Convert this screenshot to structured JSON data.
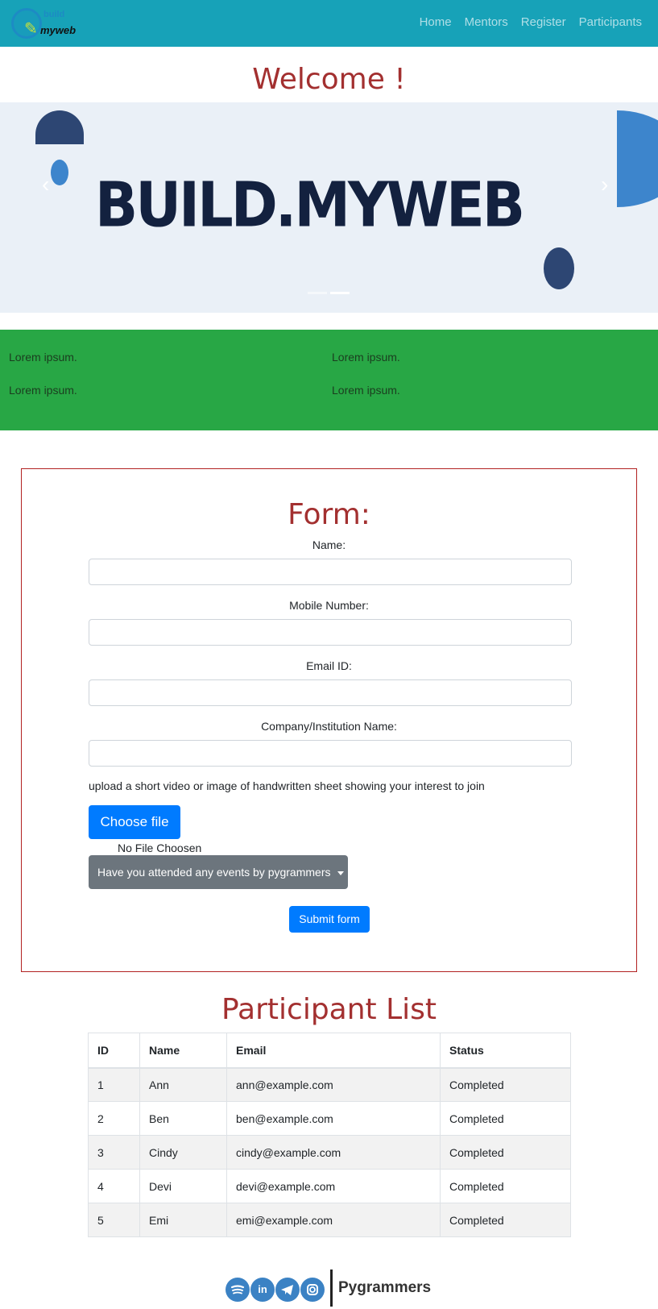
{
  "navbar": {
    "logo": {
      "top_text": "build",
      "text": "myweb",
      "icon": "wrench-icon"
    },
    "links": [
      "Home",
      "Mentors",
      "Register",
      "Participants"
    ]
  },
  "welcome": "Welcome !",
  "carousel": {
    "title": "BUILD.MYWEB",
    "prev_icon": "chevron-left-icon",
    "next_icon": "chevron-right-icon",
    "prev_glyph": "‹",
    "next_glyph": "›",
    "slides": 2,
    "active_slide": 2
  },
  "green_section": {
    "items": [
      "Lorem ipsum.",
      "Lorem ipsum.",
      "Lorem ipsum.",
      "Lorem ipsum."
    ],
    "color": "#28a745"
  },
  "form": {
    "title": "Form:",
    "fields": [
      {
        "label": "Name:",
        "value": ""
      },
      {
        "label": "Mobile Number:",
        "value": ""
      },
      {
        "label": "Email ID:",
        "value": ""
      },
      {
        "label": "Company/Institution Name:",
        "value": ""
      }
    ],
    "upload_text": "upload a short video or image of handwritten sheet showing your interest to join",
    "choose_file": "Choose file",
    "no_file": "No File Choosen",
    "dropdown": "Have you attended any events by pygrammers",
    "submit": "Submit form"
  },
  "participants": {
    "title": "Participant List",
    "columns": [
      "ID",
      "Name",
      "Email",
      "Status"
    ],
    "rows": [
      [
        "1",
        "Ann",
        "ann@example.com",
        "Completed"
      ],
      [
        "2",
        "Ben",
        "ben@example.com",
        "Completed"
      ],
      [
        "3",
        "Cindy",
        "cindy@example.com",
        "Completed"
      ],
      [
        "4",
        "Devi",
        "devi@example.com",
        "Completed"
      ],
      [
        "5",
        "Emi",
        "emi@example.com",
        "Completed"
      ]
    ]
  },
  "footer": {
    "icons": [
      "spotify-icon",
      "linkedin-icon",
      "telegram-icon",
      "instagram-icon"
    ],
    "brand": "Pygrammers"
  },
  "colors": {
    "navbar": "#17a2b8",
    "heading": "#a33030",
    "primary": "#007bff",
    "secondary": "#6c757d",
    "form_border": "#b22222"
  }
}
